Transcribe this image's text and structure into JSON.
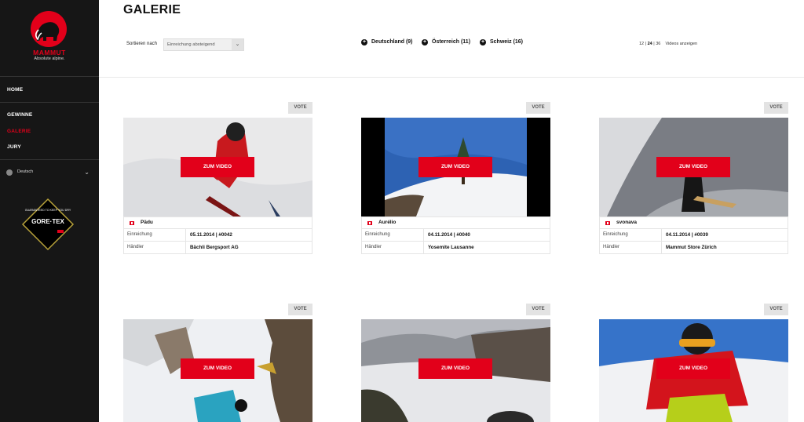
{
  "brand": {
    "name": "MAMMUT",
    "tagline": "Absolute alpine.",
    "accent": "#e2001a"
  },
  "sidebar": {
    "items": [
      {
        "label": "HOME"
      },
      {
        "label": "GEWINNE"
      },
      {
        "label": "GALERIE",
        "active": true
      },
      {
        "label": "JURY"
      }
    ],
    "language": "Deutsch",
    "badge": {
      "title": "GORE·TEX",
      "small": "GUARANTEED TO KEEP YOU DRY"
    }
  },
  "header": {
    "title": "GALERIE",
    "sort_label": "Sortieren nach",
    "sort_value": "Einreichung absteigend",
    "filters": [
      {
        "label": "Deutschland (9)"
      },
      {
        "label": "Österreich (11)"
      },
      {
        "label": "Schweiz (16)"
      }
    ],
    "pager": {
      "opt1": "12",
      "opt2": "24",
      "opt3": "36",
      "suffix": "Videos anzeigen"
    }
  },
  "labels": {
    "vote": "VOTE",
    "cta": "ZUM VIDEO",
    "submitted": "Einreichung",
    "dealer": "Händler"
  },
  "cards": [
    {
      "user": "Pädu",
      "date": "05.11.2014 | #0042",
      "dealer": "Bächli Bergsport AG",
      "icon": "swiss-flag-icon"
    },
    {
      "user": "Aurélio",
      "date": "04.11.2014 | #0040",
      "dealer": "Yosemite Lausanne",
      "icon": "swiss-flag-icon"
    },
    {
      "user": "svonava",
      "date": "04.11.2014 | #0039",
      "dealer": "Mammut Store Zürich",
      "icon": "swiss-flag-icon"
    },
    {
      "user": "",
      "date": "",
      "dealer": ""
    },
    {
      "user": "",
      "date": "",
      "dealer": ""
    },
    {
      "user": "",
      "date": "",
      "dealer": ""
    }
  ]
}
